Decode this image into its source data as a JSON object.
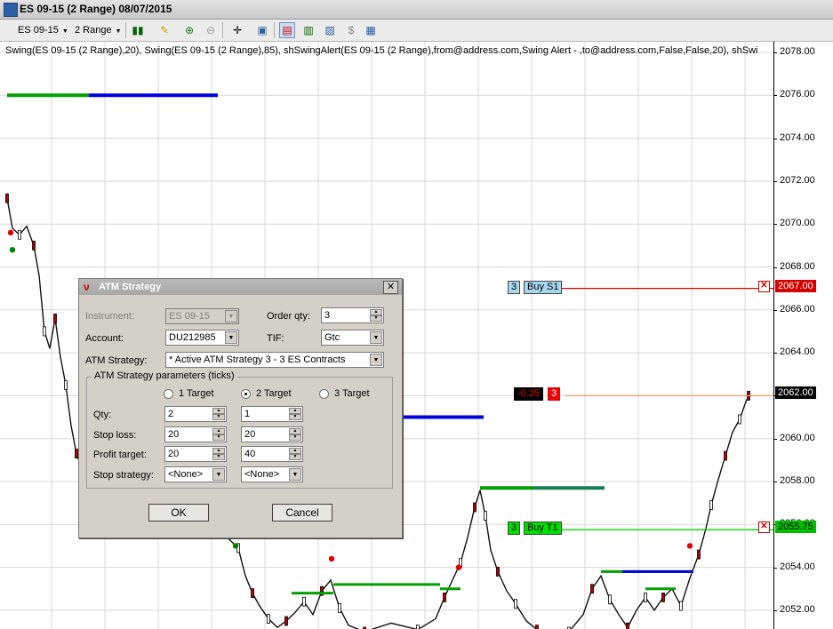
{
  "window": {
    "title": "ES 09-15 (2 Range)  08/07/2015"
  },
  "toolbar": {
    "instrument": "ES 09-15",
    "period": "2 Range"
  },
  "chart": {
    "indicators": "Swing(ES 09-15 (2 Range),20), Swing(ES 09-15 (2 Range),85), shSwingAlert(ES 09-15 (2 Range),from@address.com,Swing Alert - ,to@address.com,False,False,20), shSwi",
    "y_ticks": [
      "2078.00",
      "2076.00",
      "2074.00",
      "2072.00",
      "2070.00",
      "2068.00",
      "2066.00",
      "2064.00",
      "2062.00",
      "2060.00",
      "2058.00",
      "2056.00",
      "2054.00",
      "2052.00"
    ],
    "price_boxes": {
      "stop": "2067.00",
      "last": "2062.00",
      "target": "2055.75"
    },
    "orders": {
      "stop": {
        "qty": "3",
        "label": "Buy S1"
      },
      "position": {
        "pnl": "-0.25",
        "qty": "3"
      },
      "target": {
        "qty": "3",
        "label": "Buy T1"
      }
    },
    "colors": {
      "stop": "#d40000",
      "target": "#00dd00",
      "last": "#e8a070",
      "swing_high": "#0000e0",
      "swing_low": "#00a000"
    }
  },
  "dialog": {
    "title": "ATM Strategy",
    "instrument_label": "Instrument:",
    "instrument_value": "ES 09-15",
    "order_qty_label": "Order qty:",
    "order_qty_value": "3",
    "account_label": "Account:",
    "account_value": "DU212985",
    "tif_label": "TIF:",
    "tif_value": "Gtc",
    "atm_label": "ATM Strategy:",
    "atm_value": "* Active ATM Strategy 3 - 3 ES Contracts",
    "group_title": "ATM Strategy parameters (ticks)",
    "targets": [
      "1 Target",
      "2 Target",
      "3 Target"
    ],
    "selected_target": "2 Target",
    "qty_label": "Qty:",
    "stop_loss_label": "Stop loss:",
    "profit_target_label": "Profit target:",
    "stop_strategy_label": "Stop strategy:",
    "qty_values": [
      "2",
      "1"
    ],
    "stop_loss_values": [
      "20",
      "20"
    ],
    "profit_target_values": [
      "20",
      "40"
    ],
    "stop_strategy_values": [
      "<None>",
      "<None>"
    ],
    "ok_label": "OK",
    "cancel_label": "Cancel"
  }
}
